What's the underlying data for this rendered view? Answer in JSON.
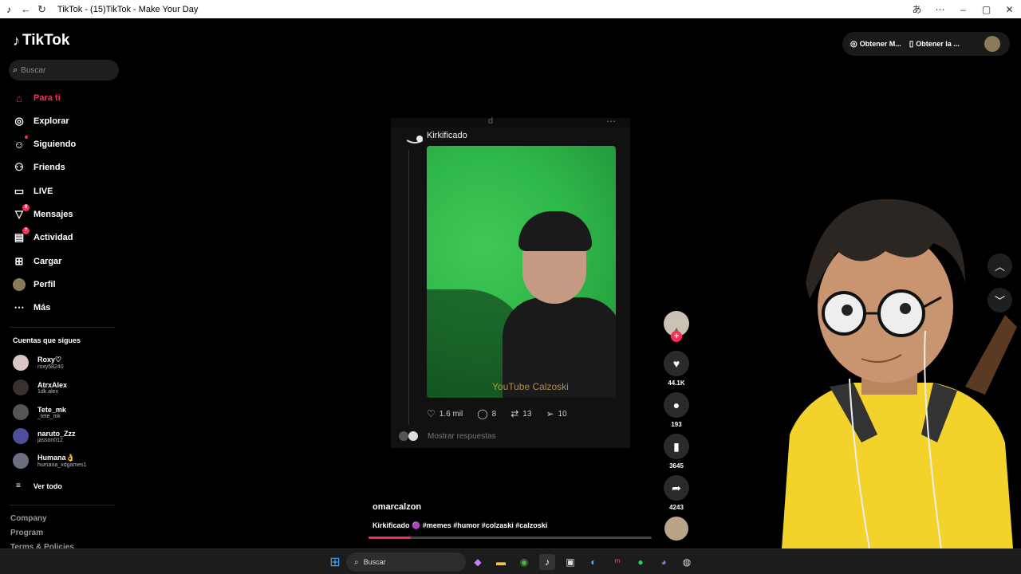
{
  "window": {
    "title": "TikTok - (15)TikTok - Make Your Day"
  },
  "sidebar": {
    "logo": "TikTok",
    "search_placeholder": "Buscar",
    "nav": [
      {
        "label": "Para ti",
        "icon": "home-icon",
        "active": true
      },
      {
        "label": "Explorar",
        "icon": "compass-icon"
      },
      {
        "label": "Siguiendo",
        "icon": "following-icon"
      },
      {
        "label": "Friends",
        "icon": "friends-icon"
      },
      {
        "label": "LIVE",
        "icon": "live-icon"
      },
      {
        "label": "Mensajes",
        "icon": "messages-icon",
        "badge": "8"
      },
      {
        "label": "Actividad",
        "icon": "activity-icon",
        "badge": "7"
      },
      {
        "label": "Cargar",
        "icon": "upload-icon"
      },
      {
        "label": "Perfil",
        "icon": "profile-avatar"
      },
      {
        "label": "Más",
        "icon": "more-icon"
      }
    ],
    "following_title": "Cuentas que sigues",
    "accounts": [
      {
        "name": "Roxy♡",
        "handle": "roxy58240"
      },
      {
        "name": "AtrxAlex",
        "handle": "1dk.alex"
      },
      {
        "name": "Tete_mk",
        "handle": "_tete_mk"
      },
      {
        "name": "naruto_Zzz",
        "handle": "jasson012"
      },
      {
        "name": "Humana👌",
        "handle": "humana_xdgames1"
      }
    ],
    "see_all": "Ver todo",
    "footer": [
      "Company",
      "Program",
      "Terms & Policies"
    ]
  },
  "header": {
    "get_coins": "Obtener M...",
    "get_app": "Obtener la ..."
  },
  "post": {
    "username": "Kirkificado",
    "watermark": "YouTube Calzoski",
    "likes": "1.6 mil",
    "comments": "8",
    "reposts": "13",
    "shares": "10",
    "replies_label": "Mostrar respuestas"
  },
  "actions": {
    "likes": "44.1K",
    "comments": "193",
    "saves": "3645",
    "shares": "4243"
  },
  "caption": {
    "author": "omarcalzon",
    "text": "Kirkificado 🟣 #memes #humor #colzaski #calzoski"
  },
  "progress": {
    "value": 0.15
  },
  "taskbar": {
    "search_placeholder": "Buscar"
  },
  "colors": {
    "accent": "#fe2c55",
    "background": "#000000"
  }
}
